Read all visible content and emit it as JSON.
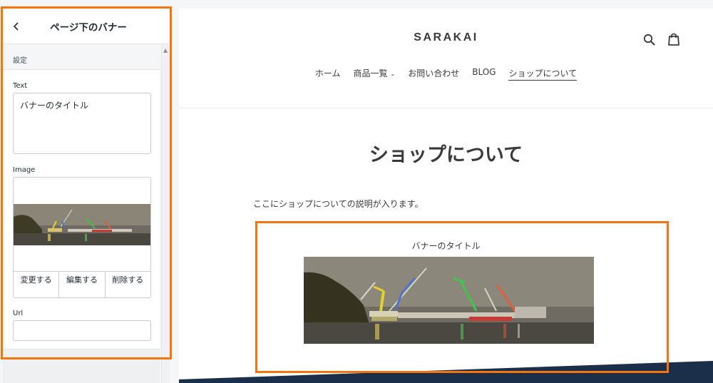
{
  "panel": {
    "title": "ページ下のバナー",
    "section_title": "設定",
    "text_label": "Text",
    "text_value": "バナーのタイトル",
    "image_label": "Image",
    "image_buttons": [
      "変更する",
      "編集する",
      "削除する"
    ],
    "url_label": "Url",
    "url_value": ""
  },
  "site": {
    "logo": "SARAKAI",
    "nav": [
      {
        "label": "ホーム",
        "dropdown": false,
        "active": false
      },
      {
        "label": "商品一覧",
        "dropdown": true,
        "active": false
      },
      {
        "label": "お問い合わせ",
        "dropdown": false,
        "active": false
      },
      {
        "label": "BLOG",
        "dropdown": false,
        "active": false
      },
      {
        "label": "ショップについて",
        "dropdown": false,
        "active": true
      }
    ],
    "page_title": "ショップについて",
    "description": "ここにショップについての説明が入ります。",
    "banner_title": "バナーのタイトル"
  },
  "colors": {
    "highlight": "#f5740e",
    "footer": "#1b2f4a"
  }
}
